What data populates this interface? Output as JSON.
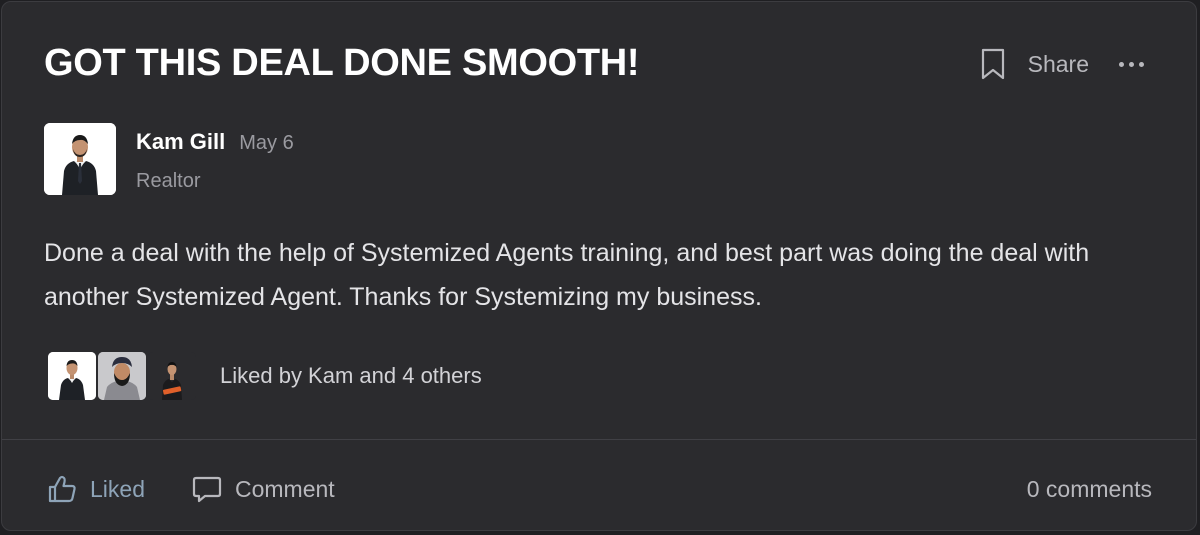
{
  "post": {
    "title": "GOT THIS DEAL DONE SMOOTH!",
    "share_label": "Share",
    "body": "Done a deal with the help of Systemized Agents training, and best part was doing the deal with another Systemized Agent. Thanks for Systemizing my business."
  },
  "author": {
    "name": "Kam Gill",
    "date": "May 6",
    "role": "Realtor"
  },
  "likes": {
    "text": "Liked by Kam and 4 others"
  },
  "footer": {
    "like_label": "Liked",
    "comment_label": "Comment",
    "comment_count": "0 comments"
  },
  "icons": {
    "bookmark": "bookmark-icon",
    "more": "more-icon",
    "like": "thumbs-up-icon",
    "comment": "comment-icon"
  },
  "colors": {
    "card_background": "#2b2b2e",
    "liked_accent": "#8ea4b8",
    "title": "#ffffff"
  }
}
